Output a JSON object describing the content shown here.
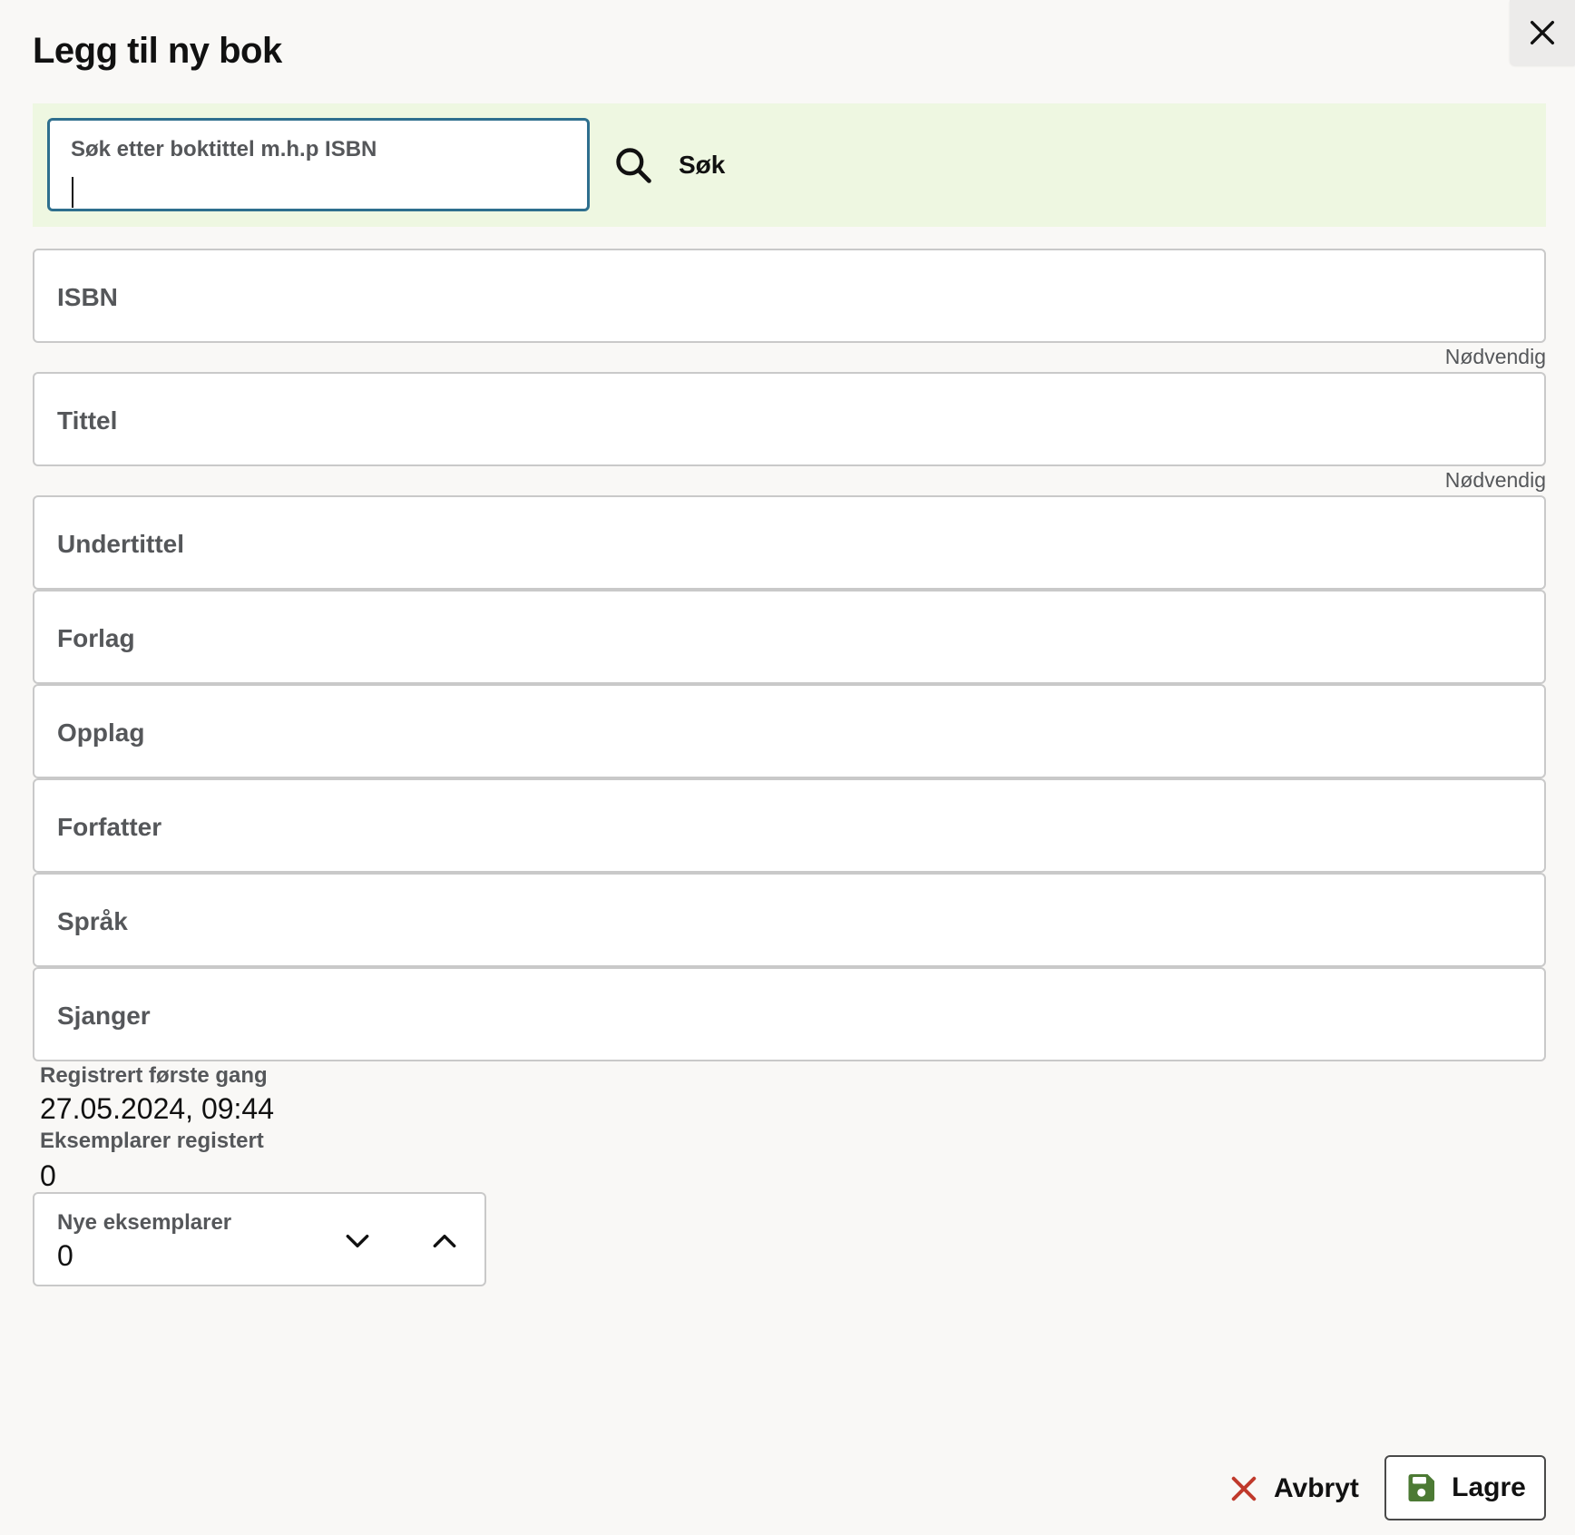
{
  "dialog": {
    "title": "Legg til ny bok"
  },
  "close": {
    "icon": "close-icon"
  },
  "search": {
    "label": "Søk etter boktittel m.h.p ISBN",
    "value": "",
    "button_label": "Søk",
    "icon": "search-icon",
    "band_color": "#eef7e1",
    "focus_color": "#2e6f8e"
  },
  "fields": [
    {
      "label": "ISBN",
      "value": "",
      "hint": "Nødvendig"
    },
    {
      "label": "Tittel",
      "value": "",
      "hint": "Nødvendig"
    },
    {
      "label": "Undertittel",
      "value": "",
      "hint": ""
    },
    {
      "label": "Forlag",
      "value": "",
      "hint": ""
    },
    {
      "label": "Opplag",
      "value": "",
      "hint": ""
    },
    {
      "label": "Forfatter",
      "value": "",
      "hint": ""
    },
    {
      "label": "Språk",
      "value": "",
      "hint": ""
    },
    {
      "label": "Sjanger",
      "value": "",
      "hint": ""
    }
  ],
  "meta": {
    "registered_label": "Registrert første gang",
    "registered_value": "27.05.2024, 09:44",
    "copies_label": "Eksemplarer registert",
    "copies_value": "0"
  },
  "new_copies": {
    "label": "Nye eksemplarer",
    "value": "0",
    "decrement_icon": "chevron-down-icon",
    "increment_icon": "chevron-up-icon"
  },
  "actions": {
    "cancel_label": "Avbryt",
    "cancel_icon": "x-icon",
    "cancel_icon_color": "#c0392b",
    "save_label": "Lagre",
    "save_icon": "save-icon",
    "save_icon_color": "#4c7a34"
  }
}
